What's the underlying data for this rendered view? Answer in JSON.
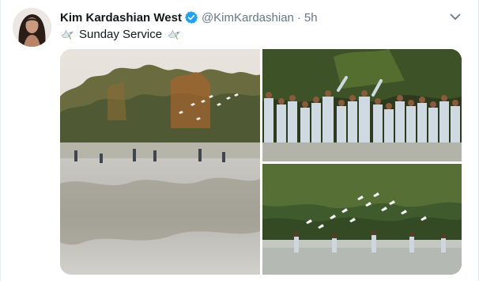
{
  "tweet": {
    "author_name": "Kim Kardashian West",
    "handle": "@KimKardashian",
    "separator": "·",
    "time": "5h",
    "text": "Sunday Service",
    "leading_emoji": "dove-icon",
    "trailing_emoji": "dove-icon"
  },
  "icons": {
    "verified": "verified-badge-icon",
    "more": "chevron-down-icon"
  },
  "colors": {
    "verified_blue": "#1da1f2",
    "secondary_text": "#657786",
    "primary_text": "#14171a",
    "border": "#e6ecf0"
  }
}
